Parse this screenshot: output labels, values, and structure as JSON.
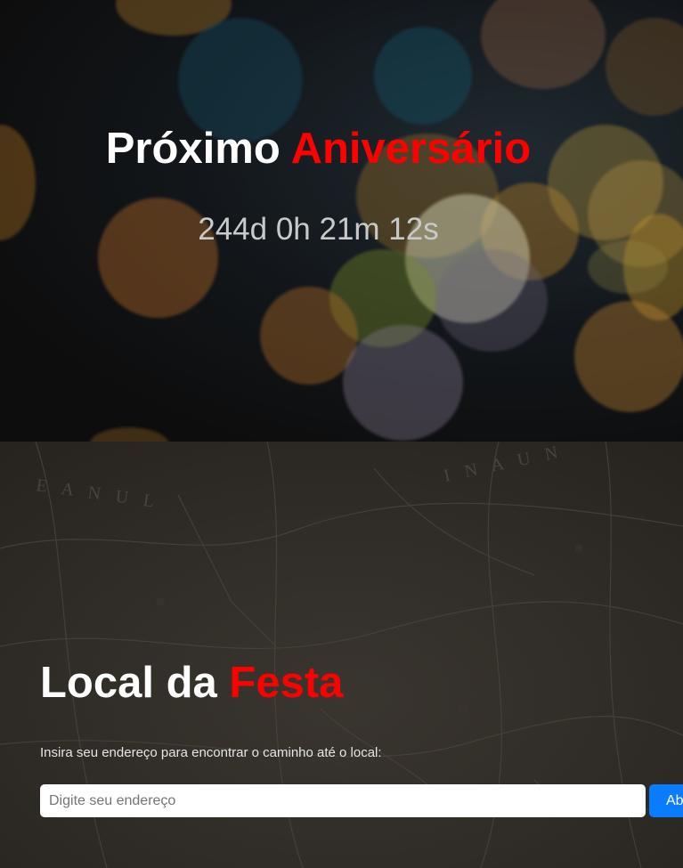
{
  "countdown_section": {
    "title_main": "Próximo",
    "title_accent": "Aniversário",
    "timer": "244d 0h 21m 12s"
  },
  "location_section": {
    "title_main": "Local da",
    "title_accent": "Festa",
    "description": "Insira seu endereço para encontrar o caminho até o local:",
    "address_input": {
      "value": "",
      "placeholder": "Digite seu endereço"
    },
    "submit_button_label": "Ab"
  },
  "colors": {
    "accent": "#ff0000",
    "button": "#0a7cff",
    "timer_text": "#c9c9c9"
  }
}
